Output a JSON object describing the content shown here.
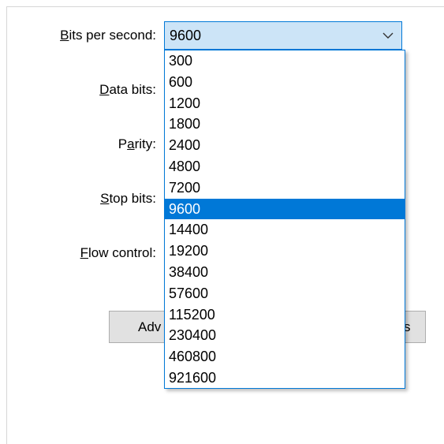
{
  "labels": {
    "bits_per_second": {
      "accel": "B",
      "rest": "its per second:"
    },
    "data_bits": {
      "accel": "D",
      "rest": "ata bits:"
    },
    "parity": {
      "pre": "P",
      "accel": "a",
      "rest": "rity:"
    },
    "stop_bits": {
      "accel": "S",
      "rest": "top bits:"
    },
    "flow_control": {
      "accel": "F",
      "rest": "low control:"
    }
  },
  "bits_per_second_combo": {
    "value": "9600",
    "options": [
      "300",
      "600",
      "1200",
      "1800",
      "2400",
      "4800",
      "7200",
      "9600",
      "14400",
      "19200",
      "38400",
      "57600",
      "115200",
      "230400",
      "460800",
      "921600"
    ],
    "selected": "9600"
  },
  "buttons": {
    "advanced_partial": "Adv",
    "restore_partial": "s"
  },
  "colors": {
    "accent": "#0078d7",
    "combo_bg": "#cce4f7",
    "button_bg": "#e1e1e1"
  }
}
